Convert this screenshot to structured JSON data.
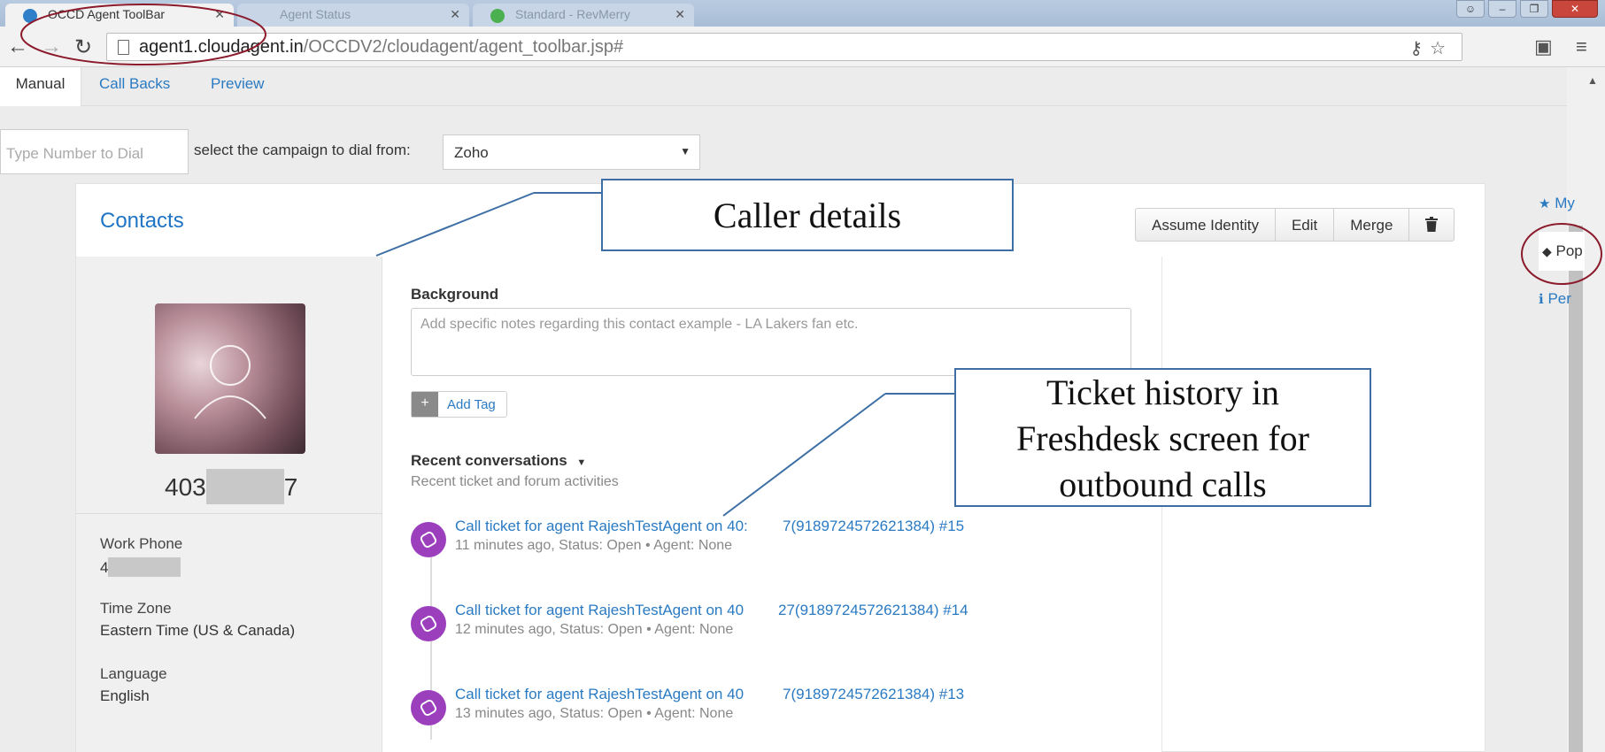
{
  "browser": {
    "active_tab": "OCCD Agent ToolBar",
    "inactive_tabs": [
      "Agent Status",
      "Standard - RevMerry"
    ],
    "url_host": "agent1.cloudagent.in",
    "url_path": "/OCCDV2/cloudagent/agent_toolbar.jsp#"
  },
  "app_tabs": [
    "Manual",
    "Call Backs",
    "Preview"
  ],
  "dialer": {
    "number_placeholder": "Type Number to Dial",
    "campaign_label": "select the campaign to dial from:",
    "campaign_value": "Zoho"
  },
  "contact": {
    "section_title": "Contacts",
    "actions": [
      "Assume Identity",
      "Edit",
      "Merge"
    ],
    "phone_prefix": "403",
    "phone_suffix": "7",
    "fields": [
      {
        "label": "Work Phone",
        "value": "4"
      },
      {
        "label": "Time Zone",
        "value": "Eastern Time (US & Canada)"
      },
      {
        "label": "Language",
        "value": "English"
      }
    ],
    "background_label": "Background",
    "background_placeholder": "Add specific notes regarding this contact example - LA Lakers fan etc.",
    "add_tag": "Add Tag",
    "recent_title": "Recent conversations",
    "recent_subtitle": "Recent ticket and forum activities",
    "conversations": [
      {
        "title": "Call ticket for agent RajeshTestAgent on 40:",
        "tail": "7(9189724572621384) #15",
        "meta": "11 minutes ago, Status: Open  •  Agent: None"
      },
      {
        "title": "Call ticket for agent RajeshTestAgent on 40",
        "tail": "27(9189724572621384) #14",
        "meta": "12 minutes ago, Status: Open  •  Agent: None"
      },
      {
        "title": "Call ticket for agent RajeshTestAgent on 40",
        "tail": "7(9189724572621384) #13",
        "meta": "13 minutes ago, Status: Open  •  Agent: None"
      }
    ]
  },
  "sidebar": [
    "My",
    "Pop",
    "Per"
  ],
  "annotations": {
    "caller": "Caller details",
    "ticket_line1": "Ticket history in",
    "ticket_line2": "Freshdesk screen for",
    "ticket_line3": "outbound calls"
  },
  "colors": {
    "accent": "#2a7ac2",
    "conversation_icon": "#9b3fbd",
    "annotation_border": "#3d6fa5",
    "highlight_ellipse": "#8b1a2b"
  }
}
